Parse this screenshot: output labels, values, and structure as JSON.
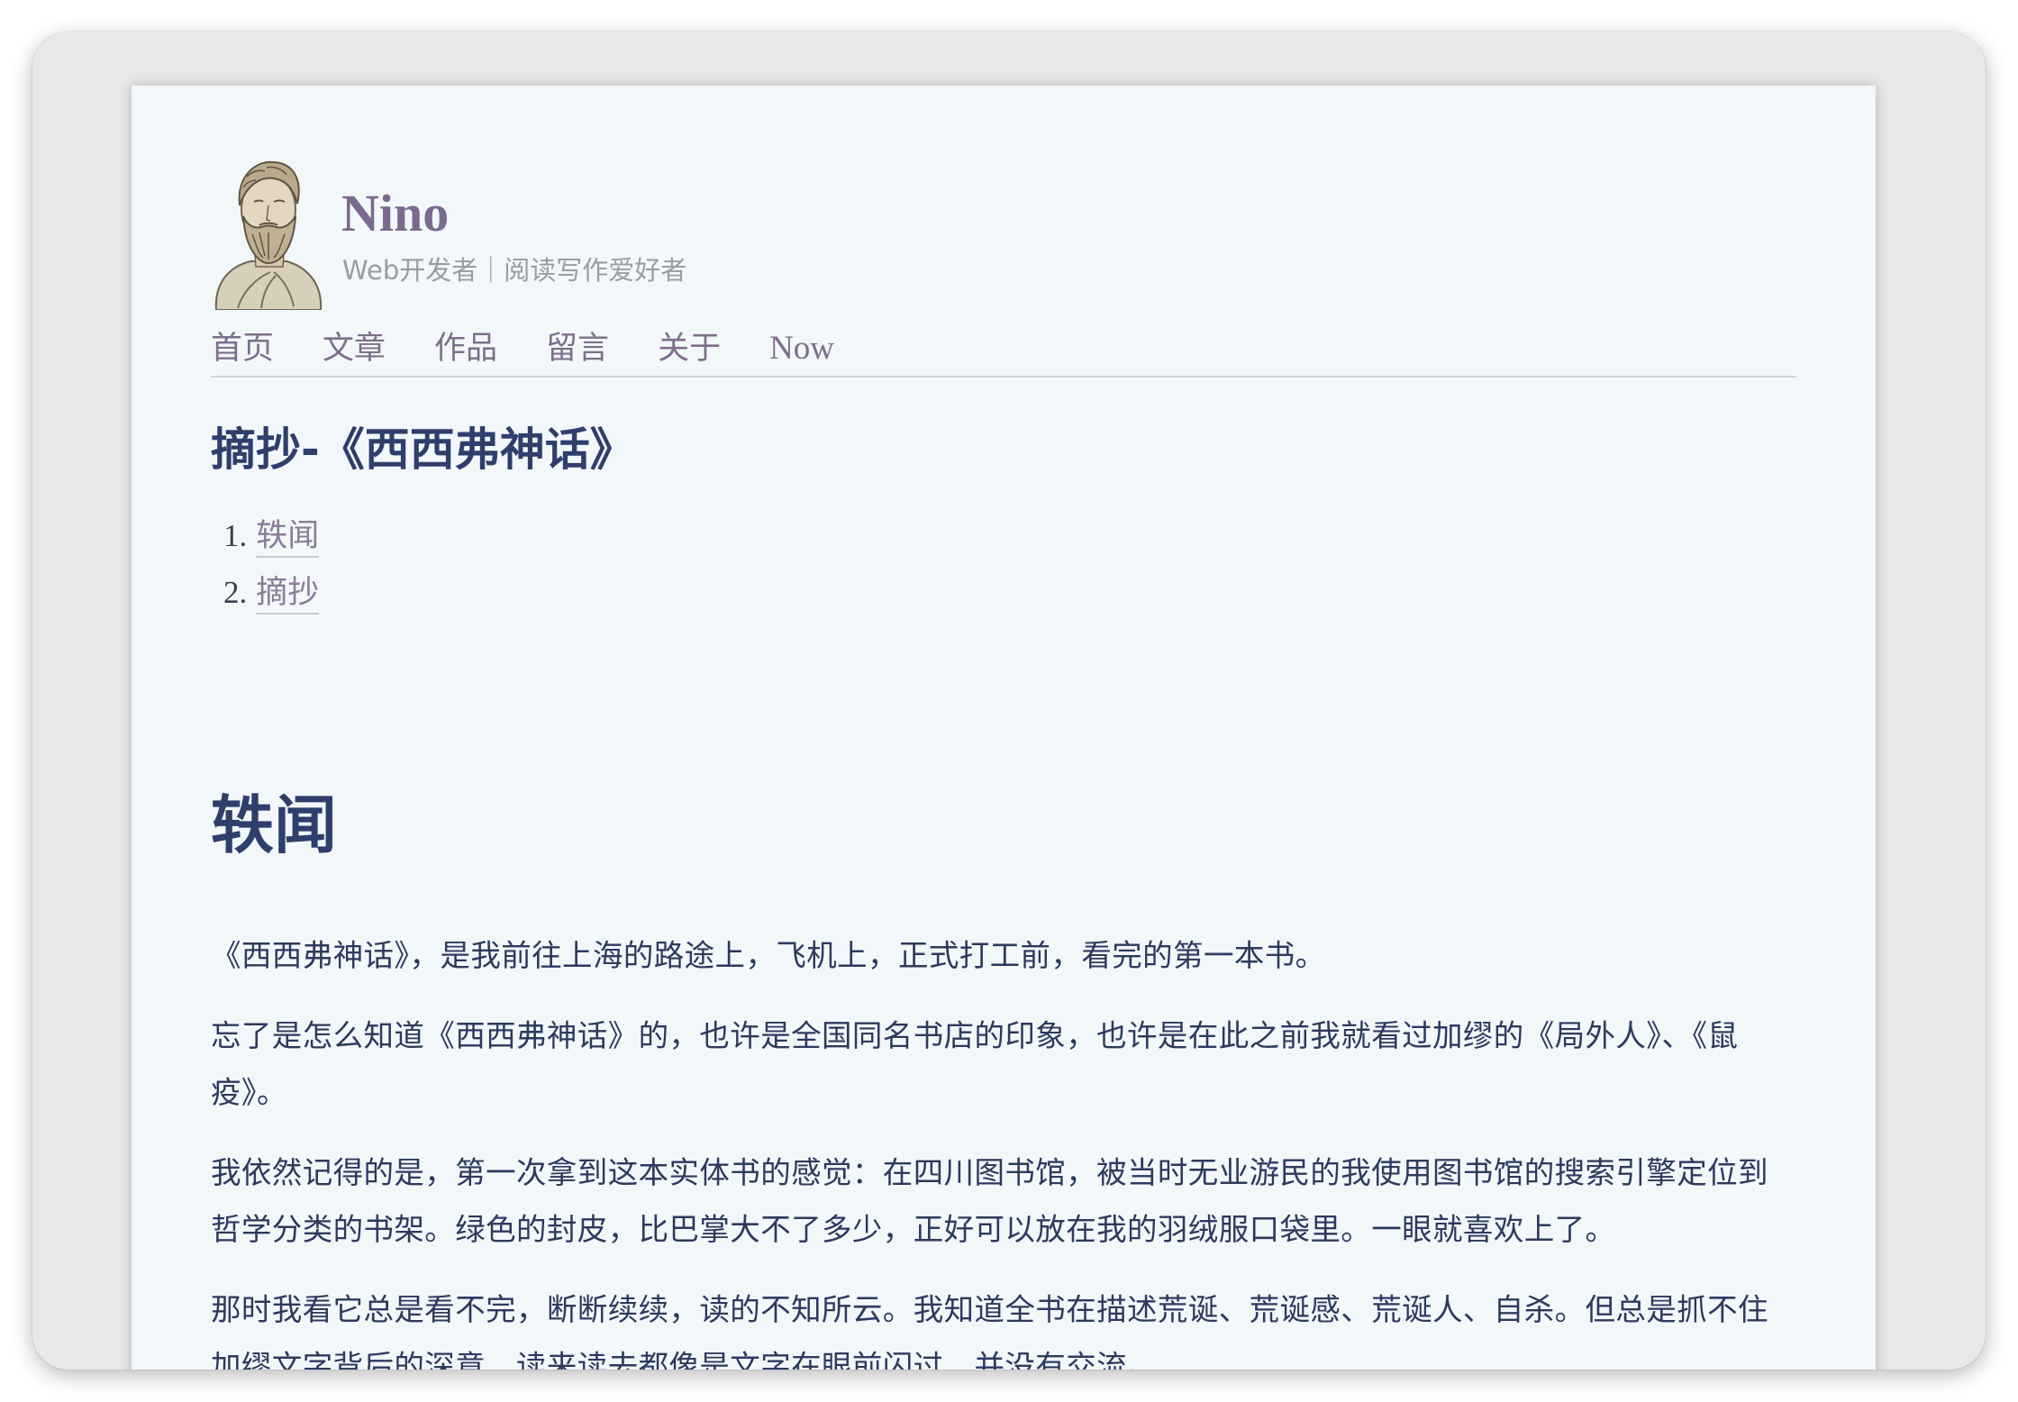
{
  "site": {
    "name": "Nino",
    "subtitle": "Web开发者｜阅读写作爱好者"
  },
  "nav": {
    "items": [
      "首页",
      "文章",
      "作品",
      "留言",
      "关于",
      "Now"
    ]
  },
  "post": {
    "title": "摘抄-《西西弗神话》",
    "toc": [
      {
        "num": "1.",
        "label": "轶闻"
      },
      {
        "num": "2.",
        "label": "摘抄"
      }
    ],
    "section_title": "轶闻",
    "paragraphs": [
      "《西西弗神话》，是我前往上海的路途上，飞机上，正式打工前，看完的第一本书。",
      "忘了是怎么知道《西西弗神话》的，也许是全国同名书店的印象，也许是在此之前我就看过加缪的《局外人》、《鼠疫》。",
      "我依然记得的是，第一次拿到这本实体书的感觉：在四川图书馆，被当时无业游民的我使用图书馆的搜索引擎定位到哲学分类的书架。绿色的封皮，比巴掌大不了多少，正好可以放在我的羽绒服口袋里。一眼就喜欢上了。",
      "那时我看它总是看不完，断断续续，读的不知所云。我知道全书在描述荒诞、荒诞感、荒诞人、自杀。但总是抓不住加缪文字背后的深意，读来读去都像是文字在眼前闪过，并没有交流。"
    ]
  },
  "colors": {
    "window_bg": "#e8e8e7",
    "page_bg": "#f2f7fa",
    "site_title": "#7a6a8e",
    "heading": "#2f3e6b",
    "link": "#8b7c99",
    "body_text": "#2c3a5e"
  },
  "icons": {
    "avatar": "bearded-philosopher-bust"
  }
}
